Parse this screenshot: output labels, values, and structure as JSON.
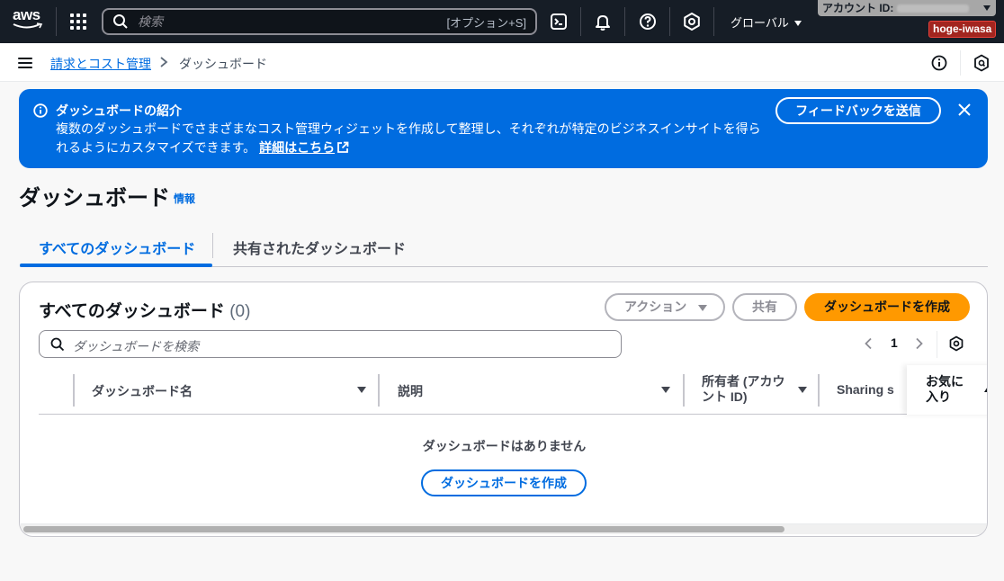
{
  "topnav": {
    "logo_text": "aws",
    "search_placeholder": "検索",
    "search_shortcut": "[オプション+S]",
    "region_label": "グローバル",
    "account_label": "アカウント ID:",
    "user_name": "hoge-iwasa"
  },
  "breadcrumb": {
    "parent": "請求とコスト管理",
    "current": "ダッシュボード"
  },
  "flash": {
    "title": "ダッシュボードの紹介",
    "body": "複数のダッシュボードでさまざまなコスト管理ウィジェットを作成して整理し、それぞれが特定のビジネスインサイトを得られるようにカスタマイズできます。",
    "link": "詳細はこちら",
    "feedback_button": "フィードバックを送信"
  },
  "page": {
    "title": "ダッシュボード",
    "info_link": "情報"
  },
  "tabs": [
    {
      "label": "すべてのダッシュボード",
      "active": true
    },
    {
      "label": "共有されたダッシュボード",
      "active": false
    }
  ],
  "table": {
    "title": "すべてのダッシュボード",
    "count": "(0)",
    "actions_button": "アクション",
    "share_button": "共有",
    "create_button": "ダッシュボードを作成",
    "search_placeholder": "ダッシュボードを検索",
    "page_number": "1",
    "columns": [
      {
        "label": "ダッシュボード名"
      },
      {
        "label": "説明"
      },
      {
        "label": "所有者 (アカウント ID)"
      },
      {
        "label": "Sharing s"
      },
      {
        "label": "お気に入り"
      }
    ],
    "empty_text": "ダッシュボードはありません",
    "empty_create_button": "ダッシュボードを作成"
  },
  "colors": {
    "nav_bg": "#161d26",
    "accent_blue": "#006ce0",
    "primary_orange": "#ff9900"
  }
}
